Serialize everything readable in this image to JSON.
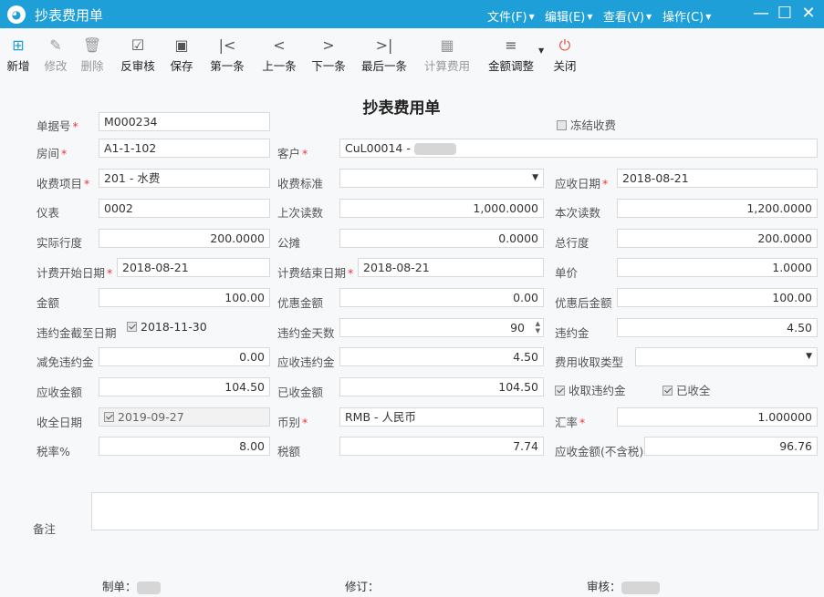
{
  "window": {
    "title": "抄表费用单",
    "menus": [
      "文件(F)",
      "编辑(E)",
      "查看(V)",
      "操作(C)"
    ]
  },
  "toolbar": [
    {
      "label": "新增",
      "icon": "add-icon"
    },
    {
      "label": "修改",
      "icon": "edit-icon"
    },
    {
      "label": "删除",
      "icon": "trash-icon"
    },
    {
      "label": "反审核",
      "icon": "unaudit-icon"
    },
    {
      "label": "保存",
      "icon": "save-icon"
    },
    {
      "label": "第一条",
      "icon": "first-icon"
    },
    {
      "label": "上一条",
      "icon": "prev-icon"
    },
    {
      "label": "下一条",
      "icon": "next-icon"
    },
    {
      "label": "最后一条",
      "icon": "last-icon"
    },
    {
      "label": "计算费用",
      "icon": "calculator-icon"
    },
    {
      "label": "金额调整",
      "icon": "adjust-icon"
    },
    {
      "label": "关闭",
      "icon": "power-icon"
    }
  ],
  "form": {
    "title": "抄表费用单",
    "labels": {
      "doc_no": "单据号",
      "room": "房间",
      "customer": "客户",
      "charge_item": "收费项目",
      "charge_standard": "收费标准",
      "due_date": "应收日期",
      "meter": "仪表",
      "last_reading": "上次读数",
      "current_reading": "本次读数",
      "actual_usage": "实际行度",
      "shared": "公摊",
      "total_usage": "总行度",
      "start_date": "计费开始日期",
      "end_date": "计费结束日期",
      "unit_price": "单价",
      "amount": "金额",
      "discount": "优惠金额",
      "after_discount": "优惠后金额",
      "penalty_cutoff": "违约金截至日期",
      "penalty_days": "违约金天数",
      "penalty": "违约金",
      "penalty_waived": "减免违约金",
      "penalty_due": "应收违约金",
      "collection_type": "费用收取类型",
      "receivable": "应收金额",
      "received": "已收金额",
      "collect_penalty": "收取违约金",
      "fully_paid": "已收全",
      "paid_date": "收全日期",
      "currency": "币别",
      "exchange_rate": "汇率",
      "tax_rate": "税率%",
      "tax": "税额",
      "receivable_excl_tax": "应收金额(不含税)",
      "freeze": "冻结收费",
      "remark": "备注"
    },
    "values": {
      "doc_no": "M000234",
      "room": "A1-1-102",
      "customer": "CuL00014 - ",
      "charge_item": "201 - 水费",
      "charge_standard": "",
      "due_date": "2018-08-21",
      "meter": "0002",
      "last_reading": "1,000.0000",
      "current_reading": "1,200.0000",
      "actual_usage": "200.0000",
      "shared": "0.0000",
      "total_usage": "200.0000",
      "start_date": "2018-08-21",
      "end_date": "2018-08-21",
      "unit_price": "1.0000",
      "amount": "100.00",
      "discount": "0.00",
      "after_discount": "100.00",
      "penalty_cutoff": "2018-11-30",
      "penalty_days": "90",
      "penalty": "4.50",
      "penalty_waived": "0.00",
      "penalty_due": "4.50",
      "collection_type": "",
      "receivable": "104.50",
      "received": "104.50",
      "paid_date": "2019-09-27",
      "currency": "RMB - 人民币",
      "exchange_rate": "1.000000",
      "tax_rate": "8.00",
      "tax": "7.74",
      "receivable_excl_tax": "96.76",
      "remark": ""
    },
    "checks": {
      "freeze": false,
      "penalty_cutoff": true,
      "collect_penalty": true,
      "fully_paid": true,
      "paid_date": true
    }
  },
  "footer": {
    "maker": "制单：",
    "revision": "修订：",
    "reviewer": "审核："
  }
}
